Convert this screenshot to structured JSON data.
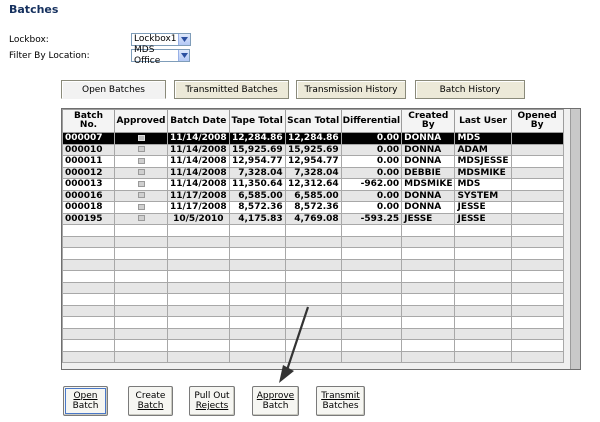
{
  "page": {
    "title": "Batches"
  },
  "filters": {
    "lockbox_label": "Lockbox:",
    "lockbox_value": "Lockbox1",
    "location_label": "Filter By Location:",
    "location_value": "MDS Office"
  },
  "tabs": [
    {
      "label": "Open Batches",
      "active": true
    },
    {
      "label": "Transmitted Batches",
      "active": false
    },
    {
      "label": "Transmission History",
      "active": false
    },
    {
      "label": "Batch History",
      "active": false
    }
  ],
  "grid": {
    "columns": [
      "Batch No.",
      "Approved",
      "Batch Date",
      "Tape Total",
      "Scan Total",
      "Differential",
      "Created By",
      "Last User",
      "Opened By"
    ],
    "rows": [
      {
        "batch_no": "000007",
        "batch_date": "11/14/2008",
        "tape_total": "12,284.86",
        "scan_total": "12,284.86",
        "differential": "0.00",
        "created_by": "DONNA",
        "last_user": "MDS",
        "opened_by": "",
        "selected": true
      },
      {
        "batch_no": "000010",
        "batch_date": "11/14/2008",
        "tape_total": "15,925.69",
        "scan_total": "15,925.69",
        "differential": "0.00",
        "created_by": "DONNA",
        "last_user": "ADAM",
        "opened_by": "",
        "selected": false
      },
      {
        "batch_no": "000011",
        "batch_date": "11/14/2008",
        "tape_total": "12,954.77",
        "scan_total": "12,954.77",
        "differential": "0.00",
        "created_by": "DONNA",
        "last_user": "MDSJESSE",
        "opened_by": "",
        "selected": false
      },
      {
        "batch_no": "000012",
        "batch_date": "11/14/2008",
        "tape_total": "7,328.04",
        "scan_total": "7,328.04",
        "differential": "0.00",
        "created_by": "DEBBIE",
        "last_user": "MDSMIKE",
        "opened_by": "",
        "selected": false
      },
      {
        "batch_no": "000013",
        "batch_date": "11/14/2008",
        "tape_total": "11,350.64",
        "scan_total": "12,312.64",
        "differential": "-962.00",
        "created_by": "MDSMIKE",
        "last_user": "MDS",
        "opened_by": "",
        "selected": false
      },
      {
        "batch_no": "000016",
        "batch_date": "11/17/2008",
        "tape_total": "6,585.00",
        "scan_total": "6,585.00",
        "differential": "0.00",
        "created_by": "DONNA",
        "last_user": "SYSTEM",
        "opened_by": "",
        "selected": false
      },
      {
        "batch_no": "000018",
        "batch_date": "11/17/2008",
        "tape_total": "8,572.36",
        "scan_total": "8,572.36",
        "differential": "0.00",
        "created_by": "DONNA",
        "last_user": "JESSE",
        "opened_by": "",
        "selected": false
      },
      {
        "batch_no": "000195",
        "batch_date": "10/5/2010",
        "tape_total": "4,175.83",
        "scan_total": "4,769.08",
        "differential": "-593.25",
        "created_by": "JESSE",
        "last_user": "JESSE",
        "opened_by": "",
        "selected": false
      }
    ]
  },
  "buttons": {
    "open_batch": {
      "line1": "Open",
      "line2": "Batch"
    },
    "create_batch": {
      "line1": "Create",
      "line2": "Batch"
    },
    "pull_out_rejects": {
      "line1": "Pull Out",
      "line2": "Rejects"
    },
    "approve_batch": {
      "line1": "Approve",
      "line2": "Batch"
    },
    "transmit_batches": {
      "line1": "Transmit",
      "line2": "Batches"
    }
  },
  "colors": {
    "title": "#15305e",
    "selected_row_bg": "#000000",
    "alt_row_bg": "#e6e6e6",
    "annotation_arrow": "#333333"
  }
}
